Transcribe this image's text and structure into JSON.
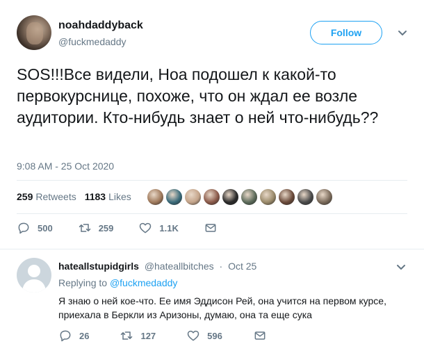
{
  "tweet": {
    "display_name": "noahdaddyback",
    "handle": "@fuckmedaddy",
    "follow_label": "Follow",
    "text": "SOS!!!Все видели, Ноа подошел к какой-то первокурснице, похоже, что он ждал ее возле аудитории. Кто-нибудь знает о ней что-нибудь??",
    "timestamp": "9:08 AM - 25 Oct 2020",
    "retweets_count": "259",
    "retweets_label": "Retweets",
    "likes_count": "1183",
    "likes_label": "Likes",
    "liker_colors": [
      "#a07a5c",
      "#3a6b7a",
      "#c4a48a",
      "#8b5a4a",
      "#2a2a2a",
      "#5c6b5a",
      "#9a8a6a",
      "#6a4a3a",
      "#4a4a4a",
      "#7a6a5a"
    ],
    "actions": {
      "replies": "500",
      "retweets": "259",
      "likes": "1.1K"
    }
  },
  "reply": {
    "display_name": "hateallstupidgirls",
    "handle": "@hateallbitches",
    "dot": "·",
    "date": "Oct 25",
    "replying_prefix": "Replying to",
    "replying_to": "@fuckmedaddy",
    "text": "Я знаю о ней кое-что. Ее имя Эддисон Рей, она учится на первом курсе, приехала в Беркли из Аризоны, думаю, она та еще сука",
    "actions": {
      "replies": "26",
      "retweets": "127",
      "likes": "596"
    }
  },
  "colors": {
    "accent": "#1da1f2",
    "secondary_text": "#657786",
    "divider": "#e6ecf0"
  }
}
